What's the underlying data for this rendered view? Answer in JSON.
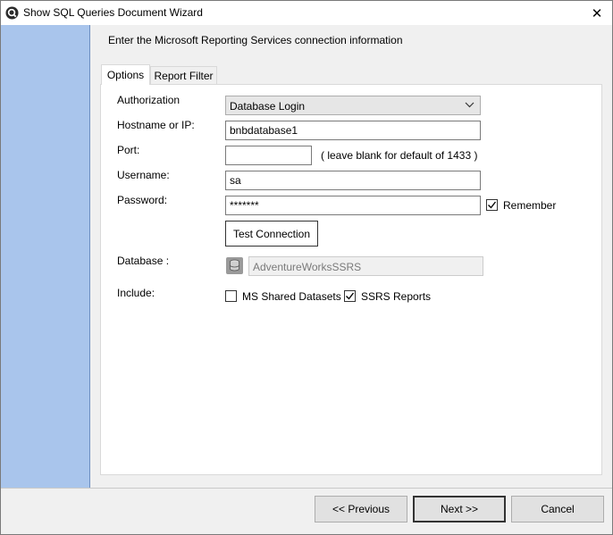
{
  "window": {
    "title": "Show SQL Queries Document Wizard",
    "close_label": "✕"
  },
  "header": {
    "instruction": "Enter the Microsoft Reporting Services connection information"
  },
  "tabs": [
    {
      "label": "Options",
      "active": true
    },
    {
      "label": "Report Filter",
      "active": false
    }
  ],
  "form": {
    "authorization": {
      "label": "Authorization",
      "value": "Database Login"
    },
    "hostname": {
      "label": "Hostname or IP:",
      "value": "bnbdatabase1"
    },
    "port": {
      "label": "Port:",
      "value": "",
      "hint": "( leave blank for default of 1433 )"
    },
    "username": {
      "label": "Username:",
      "value": "sa"
    },
    "password": {
      "label": "Password:",
      "value": "*******",
      "remember_label": "Remember",
      "remember_checked": true
    },
    "test_connection_label": "Test Connection",
    "database": {
      "label": "Database :",
      "value": "AdventureWorksSSRS",
      "icon": "database-icon"
    },
    "include": {
      "label": "Include:",
      "options": [
        {
          "label": "MS Shared Datasets",
          "checked": false
        },
        {
          "label": "SSRS Reports",
          "checked": true
        }
      ]
    }
  },
  "footer": {
    "previous_label": "<< Previous",
    "next_label": "Next >>",
    "cancel_label": "Cancel"
  },
  "colors": {
    "sidebar": "#a9c5ec",
    "background": "#f0f0f0",
    "panel": "#ffffff"
  }
}
